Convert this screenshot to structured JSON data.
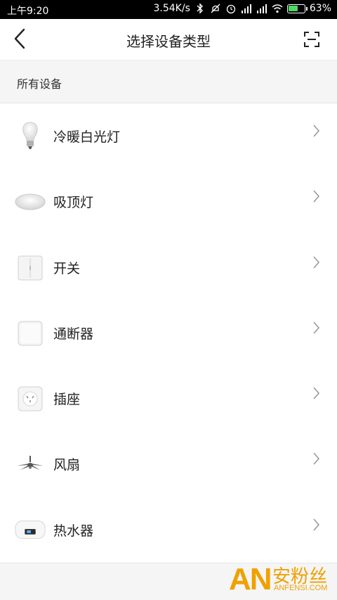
{
  "status_bar": {
    "time": "上午9:20",
    "network_speed": "3.54K/s",
    "battery_percent": "63%",
    "icons": [
      "bluetooth-icon",
      "mute-icon",
      "alarm-icon",
      "signal-icon",
      "signal-icon",
      "wifi-icon",
      "battery-icon"
    ]
  },
  "header": {
    "title": "选择设备类型",
    "back_icon": "back-arrow-icon",
    "scan_icon": "scan-icon"
  },
  "section": {
    "label": "所有设备"
  },
  "devices": [
    {
      "label": "冷暖白光灯",
      "icon": "bulb-icon"
    },
    {
      "label": "吸顶灯",
      "icon": "ceiling-light-icon"
    },
    {
      "label": "开关",
      "icon": "switch-icon"
    },
    {
      "label": "通断器",
      "icon": "breaker-icon"
    },
    {
      "label": "插座",
      "icon": "socket-icon"
    },
    {
      "label": "风扇",
      "icon": "fan-icon"
    },
    {
      "label": "热水器",
      "icon": "water-heater-icon"
    }
  ],
  "watermark": {
    "logo_letters": "AN",
    "name": "安粉丝",
    "domain": "ANFENSI.COM"
  },
  "colors": {
    "status_bar_bg": "#000000",
    "section_bg": "#f5f5f5",
    "battery_fill": "#4cd964",
    "watermark": "#f0a000"
  }
}
